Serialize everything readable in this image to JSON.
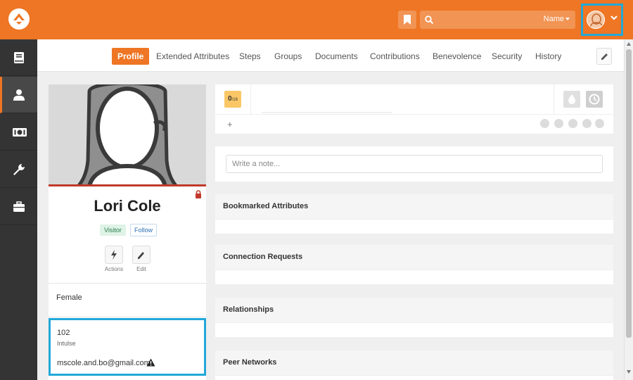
{
  "topbar": {
    "search_type_label": "Name",
    "brand_color": "#ee7624",
    "icons": [
      "rock-logo-icon",
      "bookmark-icon",
      "search-icon",
      "chevron-down-icon"
    ]
  },
  "sidebar": {
    "items": [
      {
        "name": "book-icon",
        "active": false
      },
      {
        "name": "person-icon",
        "active": true
      },
      {
        "name": "money-icon",
        "active": false
      },
      {
        "name": "wrench-icon",
        "active": false
      },
      {
        "name": "briefcase-icon",
        "active": false
      }
    ]
  },
  "tabs": [
    {
      "label": "Profile",
      "active": true
    },
    {
      "label": "Extended Attributes"
    },
    {
      "label": "Steps"
    },
    {
      "label": "Groups"
    },
    {
      "label": "Documents"
    },
    {
      "label": "Contributions"
    },
    {
      "label": "Benevolence"
    },
    {
      "label": "Security"
    },
    {
      "label": "History"
    }
  ],
  "profile": {
    "name": "Lori Cole",
    "connection_status": "Visitor",
    "follow_label": "Follow",
    "actions_label": "Actions",
    "edit_label": "Edit",
    "gender": "Female",
    "phone": "102",
    "phone_type": "Intulse",
    "email": "mscole.and.bo@gmail.com"
  },
  "badges": {
    "steps_count": "0",
    "steps_total": "/16",
    "add_label": "+"
  },
  "notes": {
    "placeholder": "Write a note..."
  },
  "sections": [
    {
      "title": "Bookmarked Attributes"
    },
    {
      "title": "Connection Requests"
    },
    {
      "title": "Relationships"
    },
    {
      "title": "Peer Networks"
    }
  ]
}
